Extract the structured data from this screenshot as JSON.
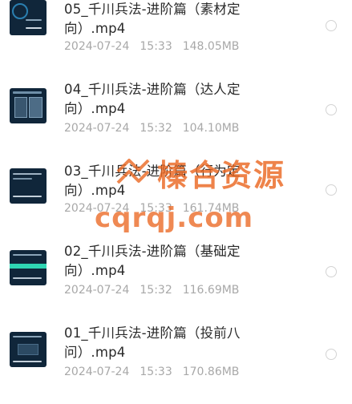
{
  "files": [
    {
      "title": "05_千川兵法-进阶篇（素材定向）.mp4",
      "date": "2024-07-24",
      "time": "15:33",
      "size": "148.05MB"
    },
    {
      "title": "04_千川兵法-进阶篇（达人定向）.mp4",
      "date": "2024-07-24",
      "time": "15:32",
      "size": "104.10MB"
    },
    {
      "title": "03_千川兵法-进阶篇（行为定向）.mp4",
      "date": "2024-07-24",
      "time": "15:33",
      "size": "161.74MB"
    },
    {
      "title": "02_千川兵法-进阶篇（基础定向）.mp4",
      "date": "2024-07-24",
      "time": "15:32",
      "size": "116.69MB"
    },
    {
      "title": "01_千川兵法-进阶篇（投前八问）.mp4",
      "date": "2024-07-24",
      "time": "15:33",
      "size": "170.86MB"
    }
  ],
  "watermark": {
    "text_cn": "榛合资源",
    "text_en": "cqrqj.com",
    "color": "#ea6822"
  },
  "colors": {
    "title": "#2a2a2a",
    "meta": "#a8a8a8",
    "thumbnail_bg": "#10263a",
    "radio_border": "#d3d3d3"
  }
}
